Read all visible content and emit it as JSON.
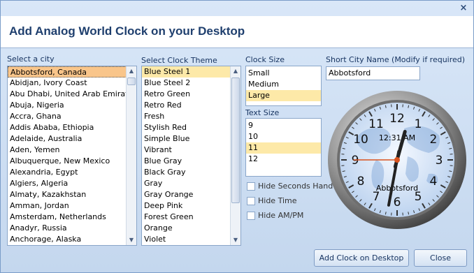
{
  "window": {
    "close_glyph": "×"
  },
  "header": {
    "title": "Add Analog World Clock on your Desktop"
  },
  "city": {
    "label": "Select a city",
    "items": [
      "Abbotsford, Canada",
      "Abidjan, Ivory Coast",
      "Abu Dhabi, United Arab Emirates",
      "Abuja, Nigeria",
      "Accra, Ghana",
      "Addis Ababa, Ethiopia",
      "Adelaide, Australia",
      "Aden, Yemen",
      "Albuquerque, New Mexico",
      "Alexandria, Egypt",
      "Algiers, Algeria",
      "Almaty, Kazakhstan",
      "Amman, Jordan",
      "Amsterdam, Netherlands",
      "Anadyr, Russia",
      "Anchorage, Alaska"
    ],
    "selected_index": 0
  },
  "theme": {
    "label": "Select Clock Theme",
    "items": [
      "Blue Steel 1",
      "Blue Steel 2",
      "Retro Green",
      "Retro Red",
      "Fresh",
      "Stylish Red",
      "Simple Blue",
      "Vibrant",
      "Blue Gray",
      "Black Gray",
      "Gray",
      "Gray Orange",
      "Deep Pink",
      "Forest Green",
      "Orange",
      "Violet"
    ],
    "selected_index": 0
  },
  "clock_size": {
    "label": "Clock Size",
    "items": [
      "Small",
      "Medium",
      "Large"
    ],
    "selected_index": 2
  },
  "text_size": {
    "label": "Text Size",
    "items": [
      "9",
      "10",
      "11",
      "12"
    ],
    "selected_index": 2
  },
  "options": {
    "hide_seconds": "Hide Seconds Hand",
    "hide_time": "Hide Time",
    "hide_ampm": "Hide AM/PM"
  },
  "short_name": {
    "label": "Short City Name (Modify if required)",
    "value": "Abbotsford"
  },
  "clock": {
    "time_text": "12:31 AM",
    "city_text": "Abbotsford",
    "numbers": [
      "12",
      "1",
      "2",
      "3",
      "4",
      "5",
      "6",
      "7",
      "8",
      "9",
      "10",
      "11"
    ],
    "hour": 0,
    "minute": 31,
    "second": 45
  },
  "buttons": {
    "add": "Add Clock on Desktop",
    "close": "Close"
  },
  "colors": {
    "accent": "#1f3f6e",
    "selection": "#fde9a8",
    "second_hand": "#d9531e"
  }
}
